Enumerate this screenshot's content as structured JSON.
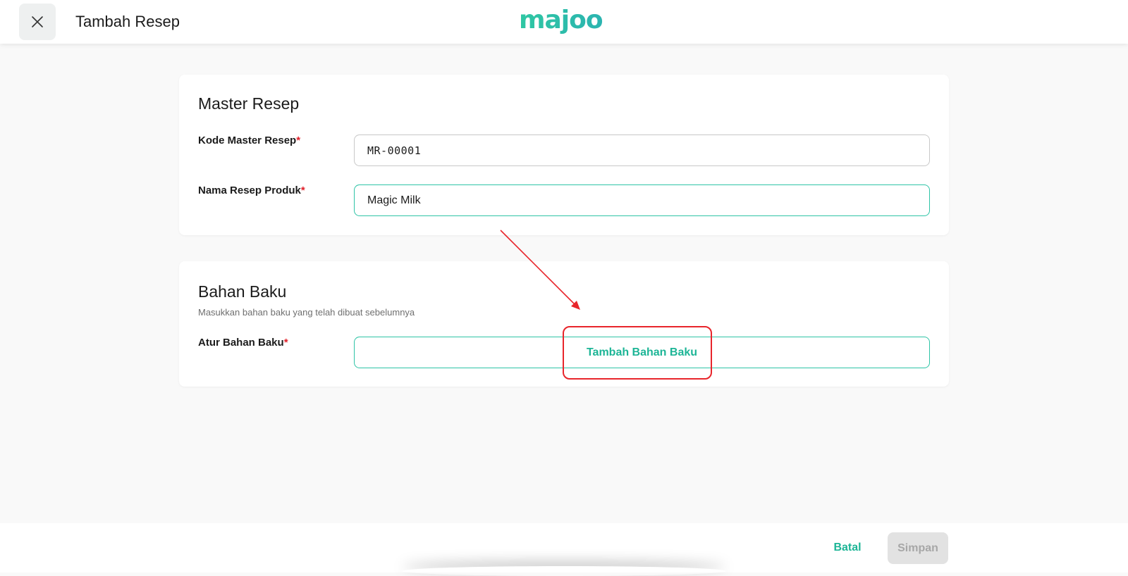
{
  "header": {
    "title": "Tambah Resep",
    "logo_text": "majoo",
    "close_icon": "close-icon"
  },
  "master_resep": {
    "title": "Master Resep",
    "kode_label": "Kode Master Resep",
    "kode_value": "MR-00001",
    "nama_label": "Nama Resep Produk",
    "nama_value": "Magic Milk",
    "required_mark": "*"
  },
  "bahan_baku": {
    "title": "Bahan Baku",
    "subtitle": "Masukkan bahan baku yang telah dibuat sebelumnya",
    "atur_label": "Atur Bahan Baku",
    "add_button_label": "Tambah Bahan Baku",
    "required_mark": "*"
  },
  "footer": {
    "cancel_label": "Batal",
    "save_label": "Simpan"
  },
  "colors": {
    "accent": "#1db596",
    "accent_border": "#2ec4a6",
    "required": "#e0202a",
    "annotation": "#e8252b",
    "disabled_bg": "#e2e2e2",
    "disabled_text": "#a7a7a7",
    "page_bg": "#f9f9f9"
  }
}
